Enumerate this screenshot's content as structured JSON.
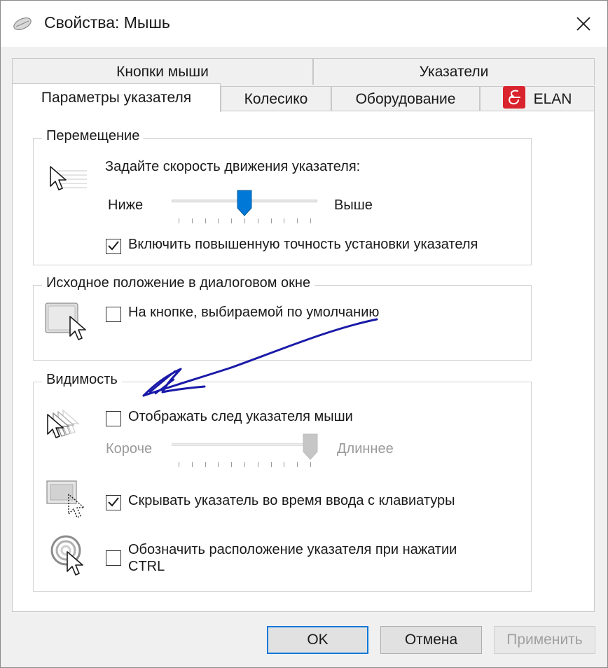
{
  "window": {
    "title": "Свойства: Мышь"
  },
  "tabs": {
    "row1": [
      {
        "label": "Кнопки мыши"
      },
      {
        "label": "Указатели"
      }
    ],
    "row2": [
      {
        "label": "Параметры указателя"
      },
      {
        "label": "Колесико"
      },
      {
        "label": "Оборудование"
      },
      {
        "label": "ELAN"
      }
    ],
    "active": "Параметры указателя"
  },
  "motion": {
    "legend": "Перемещение",
    "prompt": "Задайте скорость движения указателя:",
    "slow_label": "Ниже",
    "fast_label": "Выше",
    "speed_position": 0.5,
    "precision_label": "Включить повышенную точность установки указателя",
    "precision_checked": true
  },
  "snap_to": {
    "legend": "Исходное положение в диалоговом окне",
    "label": "На кнопке, выбираемой по умолчанию",
    "checked": false
  },
  "visibility": {
    "legend": "Видимость",
    "trails_label": "Отображать след указателя мыши",
    "trails_checked": false,
    "short_label": "Короче",
    "long_label": "Длиннее",
    "trail_length_position": 1.0,
    "hide_label": "Скрывать указатель во время ввода с клавиатуры",
    "hide_checked": true,
    "ctrl_label_line1": "Обозначить расположение указателя при нажатии",
    "ctrl_label_line2": "CTRL",
    "ctrl_checked": false
  },
  "buttons": {
    "ok": "OK",
    "cancel": "Отмена",
    "apply": "Применить"
  },
  "colors": {
    "accent": "#0078d7",
    "annotation": "#1a1aa8",
    "elan_red": "#d9232d"
  }
}
